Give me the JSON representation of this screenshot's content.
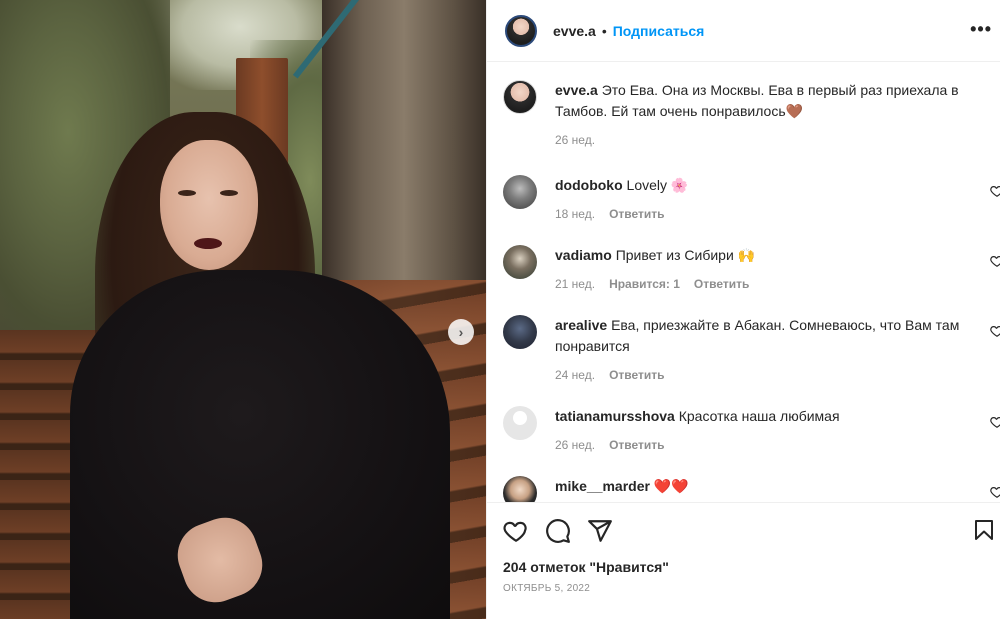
{
  "post": {
    "username": "evve.a",
    "follow_label": "Подписаться",
    "separator": "•",
    "more_label": "•••"
  },
  "caption": {
    "username": "evve.a",
    "text": "Это Ева. Она из Москвы. Ева в первый раз приехала в Тамбов. Ей там очень понравилось🤎",
    "time": "26 нед."
  },
  "comments": [
    {
      "username": "dodoboko",
      "text": "Lovely 🌸",
      "time": "18 нед.",
      "likes": "",
      "reply": "Ответить"
    },
    {
      "username": "vadiamo",
      "text": "Привет из Сибири 🙌",
      "time": "21 нед.",
      "likes": "Нравится: 1",
      "reply": "Ответить"
    },
    {
      "username": "arealive",
      "text": "Ева, приезжайте в Абакан. Сомневаюсь, что Вам там понравится",
      "time": "24 нед.",
      "likes": "",
      "reply": "Ответить"
    },
    {
      "username": "tatianamursshova",
      "text": "Красотка наша любимая",
      "time": "26 нед.",
      "likes": "",
      "reply": "Ответить"
    },
    {
      "username": "mike__marder",
      "text": "❤️❤️",
      "time": "",
      "likes": "",
      "reply": ""
    }
  ],
  "footer": {
    "likes_text": "204 отметок \"Нравится\"",
    "date_text": "Октябрь 5, 2022"
  },
  "icons": {
    "like": "heart-icon",
    "comment": "comment-bubble-icon",
    "share": "paper-plane-icon",
    "save": "bookmark-icon",
    "next": "chevron-right-icon",
    "more": "ellipsis-icon"
  },
  "colors": {
    "accent": "#0095f6",
    "text": "#262626",
    "muted": "#8e8e8e",
    "border": "#efefef"
  }
}
